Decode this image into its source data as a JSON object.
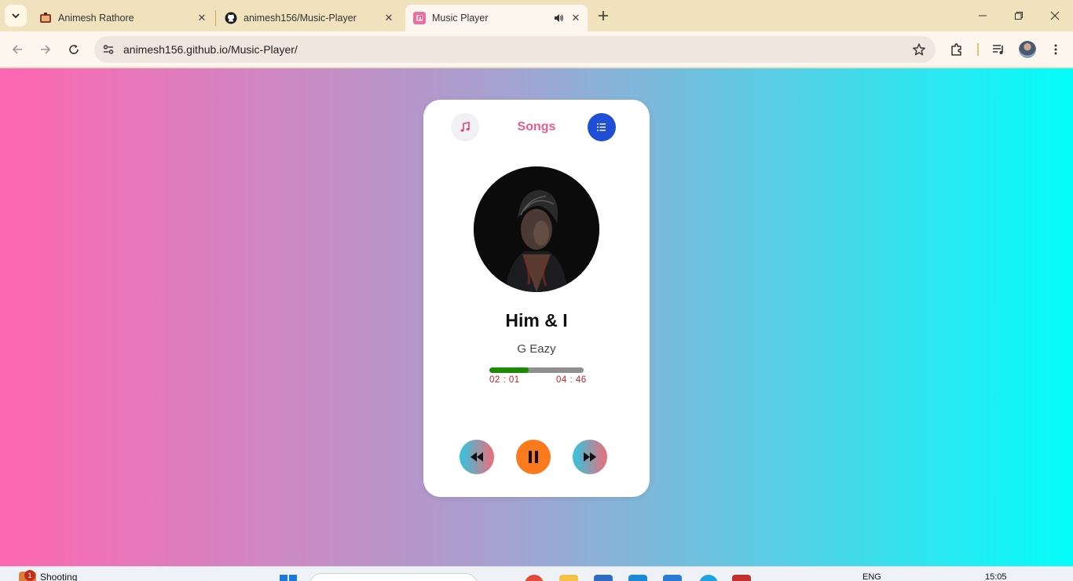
{
  "browser": {
    "tabs": [
      {
        "title": "Animesh Rathore",
        "favicon": "portfolio-favicon",
        "active": false
      },
      {
        "title": "animesh156/Music-Player",
        "favicon": "github-icon",
        "active": false
      },
      {
        "title": "Music Player",
        "favicon": "music-favicon",
        "active": true,
        "audio_playing": true
      }
    ],
    "address_bar": {
      "url": "animesh156.github.io/Music-Player/"
    }
  },
  "player": {
    "heading": "Songs",
    "song_title": "Him & I",
    "artist": "G Eazy",
    "current_time": "02 : 01",
    "total_time": "04 : 46",
    "progress_fraction": 0.42,
    "colors": {
      "heading": "#ea5b8b",
      "playlist_button": "#1f4fd6",
      "play_button": "#fb7a1e",
      "progress_fill": "#1a8a00",
      "time_text": "#c6202a"
    }
  },
  "taskbar": {
    "weather_label": "Shooting",
    "notification_count": "1",
    "language": "ENG",
    "clock": "15:05"
  }
}
